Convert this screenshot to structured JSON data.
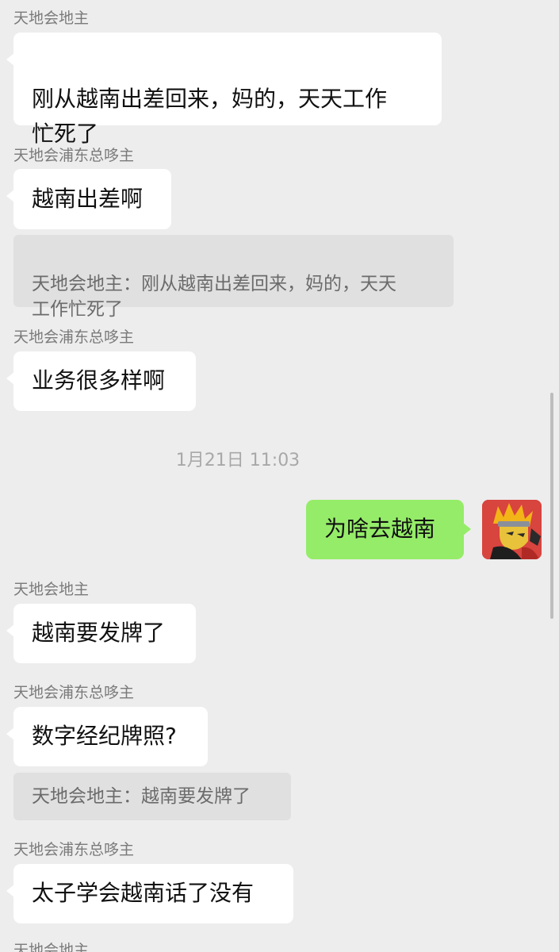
{
  "messages": [
    {
      "sender": "天地会地主",
      "text": "刚从越南出差回来，妈的，天天工作\n忙死了"
    },
    {
      "sender": "天地会浦东总哆主",
      "text": "越南出差啊",
      "quote": "天地会地主：刚从越南出差回来，妈的，天天\n工作忙死了"
    },
    {
      "sender": "天地会浦东总哆主",
      "text": "业务很多样啊"
    },
    {
      "timestamp": "1月21日 11:03"
    },
    {
      "self": true,
      "text": "为啥去越南",
      "avatar_icon": "cartoon-avatar-icon"
    },
    {
      "sender": "天地会地主",
      "text": "越南要发牌了"
    },
    {
      "sender": "天地会浦东总哆主",
      "text": "数字经纪牌照?",
      "quote": "天地会地主：越南要发牌了"
    },
    {
      "sender": "天地会浦东总哆主",
      "text": "太子学会越南话了没有"
    },
    {
      "sender": "天地会地主"
    }
  ],
  "colors": {
    "background": "#ededed",
    "incoming_bubble": "#ffffff",
    "outgoing_bubble": "#95ec69",
    "quote_background": "#e0e0e0",
    "sender_text": "#7a7a7a",
    "timestamp_text": "#a8a8a8"
  }
}
